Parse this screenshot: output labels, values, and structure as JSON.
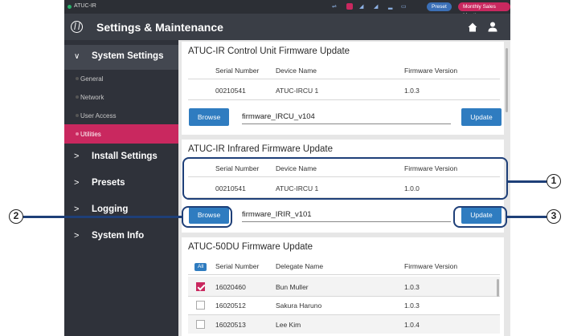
{
  "status_bar": {
    "app_name": "ATUC-IR",
    "preset_label": "Preset",
    "meeting_label": "Monthly Sales Meeting",
    "meeting_chevron": "▾"
  },
  "title_bar": {
    "title": "Settings & Maintenance"
  },
  "sidebar": {
    "system_settings": {
      "chevron": "∨",
      "label": "System Settings"
    },
    "sub_items": [
      "General",
      "Network",
      "User Access",
      "Utilities"
    ],
    "active_sub_item": "Utilities",
    "items": [
      {
        "chevron": ">",
        "label": "Install Settings"
      },
      {
        "chevron": ">",
        "label": "Presets"
      },
      {
        "chevron": ">",
        "label": "Logging"
      },
      {
        "chevron": ">",
        "label": "System Info"
      }
    ]
  },
  "control_unit": {
    "title": "ATUC-IR Control Unit Firmware Update",
    "headers": {
      "serial": "Serial Number",
      "device": "Device Name",
      "version": "Firmware Version"
    },
    "row": {
      "serial": "00210541",
      "device": "ATUC-IRCU 1",
      "version": "1.0.3"
    },
    "browse_label": "Browse",
    "file_name": "firmware_IRCU_v104",
    "update_label": "Update"
  },
  "infrared": {
    "title": "ATUC-IR Infrared Firmware Update",
    "headers": {
      "serial": "Serial Number",
      "device": "Device Name",
      "version": "Firmware Version"
    },
    "row": {
      "serial": "00210541",
      "device": "ATUC-IRCU 1",
      "version": "1.0.0"
    },
    "browse_label": "Browse",
    "file_name": "firmware_IRIR_v101",
    "update_label": "Update"
  },
  "du_update": {
    "title": "ATUC-50DU Firmware Update",
    "all_label": "All",
    "headers": {
      "serial": "Serial Number",
      "delegate": "Delegate Name",
      "version": "Firmware Version"
    },
    "rows": [
      {
        "checked": true,
        "serial": "16020460",
        "delegate": "Bun Muller",
        "version": "1.0.3"
      },
      {
        "checked": false,
        "serial": "16020512",
        "delegate": "Sakura Haruno",
        "version": "1.0.3"
      },
      {
        "checked": false,
        "serial": "16020513",
        "delegate": "Lee Kim",
        "version": "1.0.4"
      }
    ]
  },
  "callouts": {
    "one": "1",
    "two": "2",
    "three": "3"
  },
  "colors": {
    "accent": "#c9285f",
    "button": "#2f7cc0",
    "callout": "#1e3f78"
  }
}
